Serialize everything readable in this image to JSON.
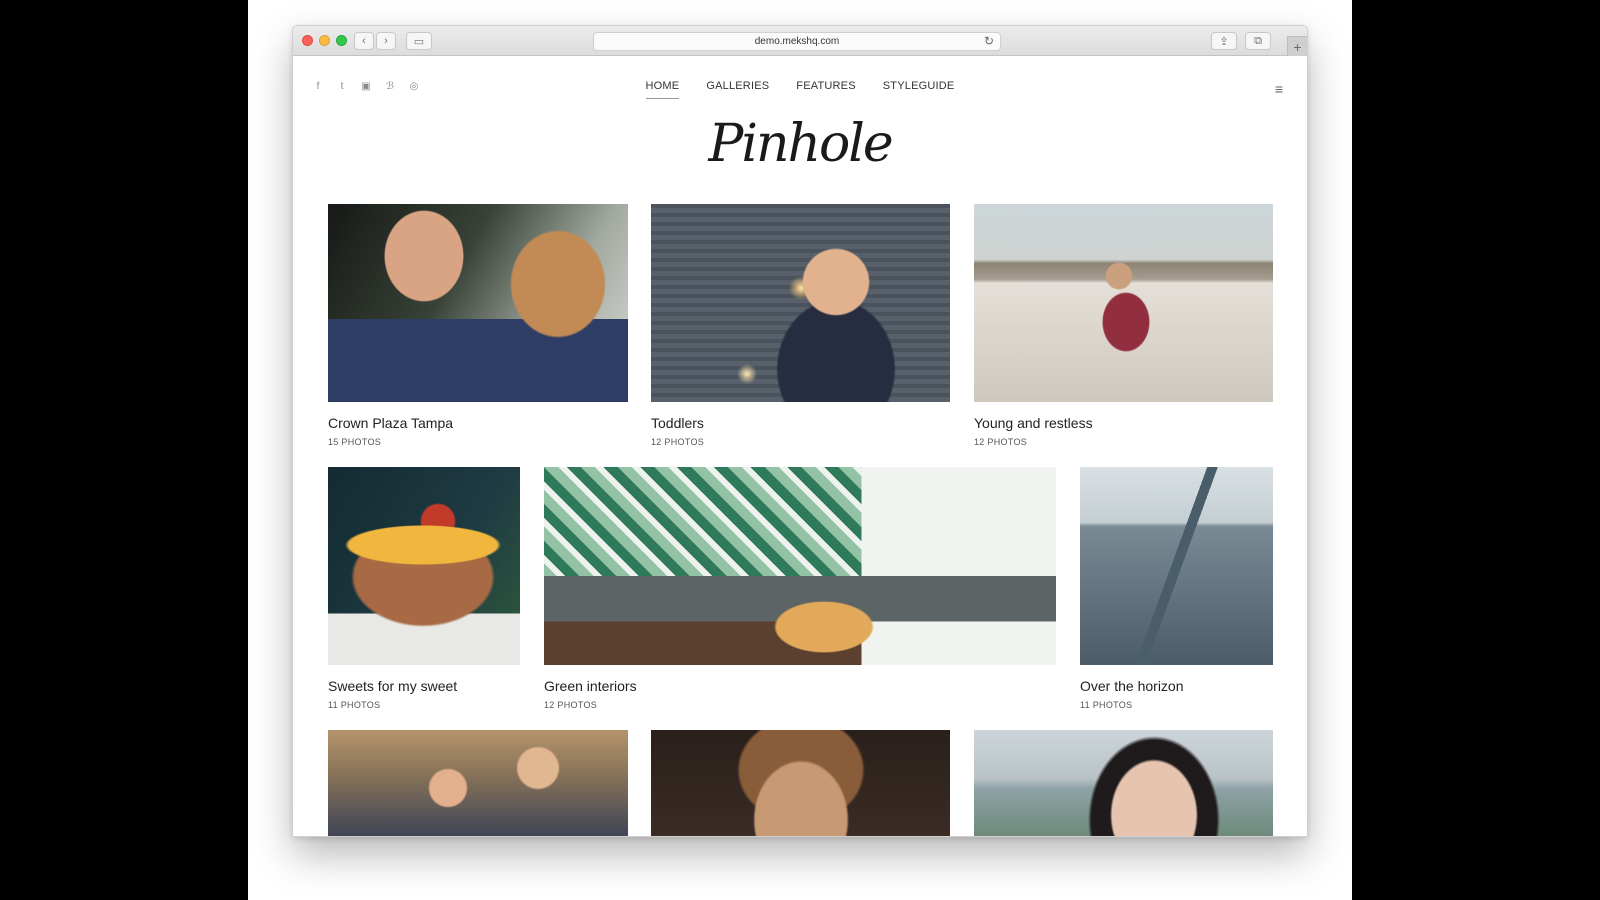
{
  "browser": {
    "url": "demo.mekshq.com",
    "icons": [
      "close-dot",
      "minimize-dot",
      "zoom-dot",
      "back-icon",
      "forward-icon",
      "sidebar-icon",
      "reload-icon",
      "share-icon",
      "tabs-icon",
      "new-tab-icon"
    ]
  },
  "site": {
    "logo": "Pinhole",
    "social": [
      "f",
      "t",
      "▣",
      "ℬ",
      "◎"
    ],
    "nav": [
      {
        "label": "HOME"
      },
      {
        "label": "GALLERIES"
      },
      {
        "label": "FEATURES"
      },
      {
        "label": "STYLEGUIDE"
      }
    ],
    "menu_icon": "≡"
  },
  "galleries": [
    {
      "title": "Crown Plaza Tampa",
      "count": "15 PHOTOS"
    },
    {
      "title": "Toddlers",
      "count": "12 PHOTOS"
    },
    {
      "title": "Young and restless",
      "count": "12 PHOTOS"
    },
    {
      "title": "Sweets for my sweet",
      "count": "11 PHOTOS"
    },
    {
      "title": "Green interiors",
      "count": "12 PHOTOS"
    },
    {
      "title": "Over the horizon",
      "count": "11 PHOTOS"
    }
  ]
}
